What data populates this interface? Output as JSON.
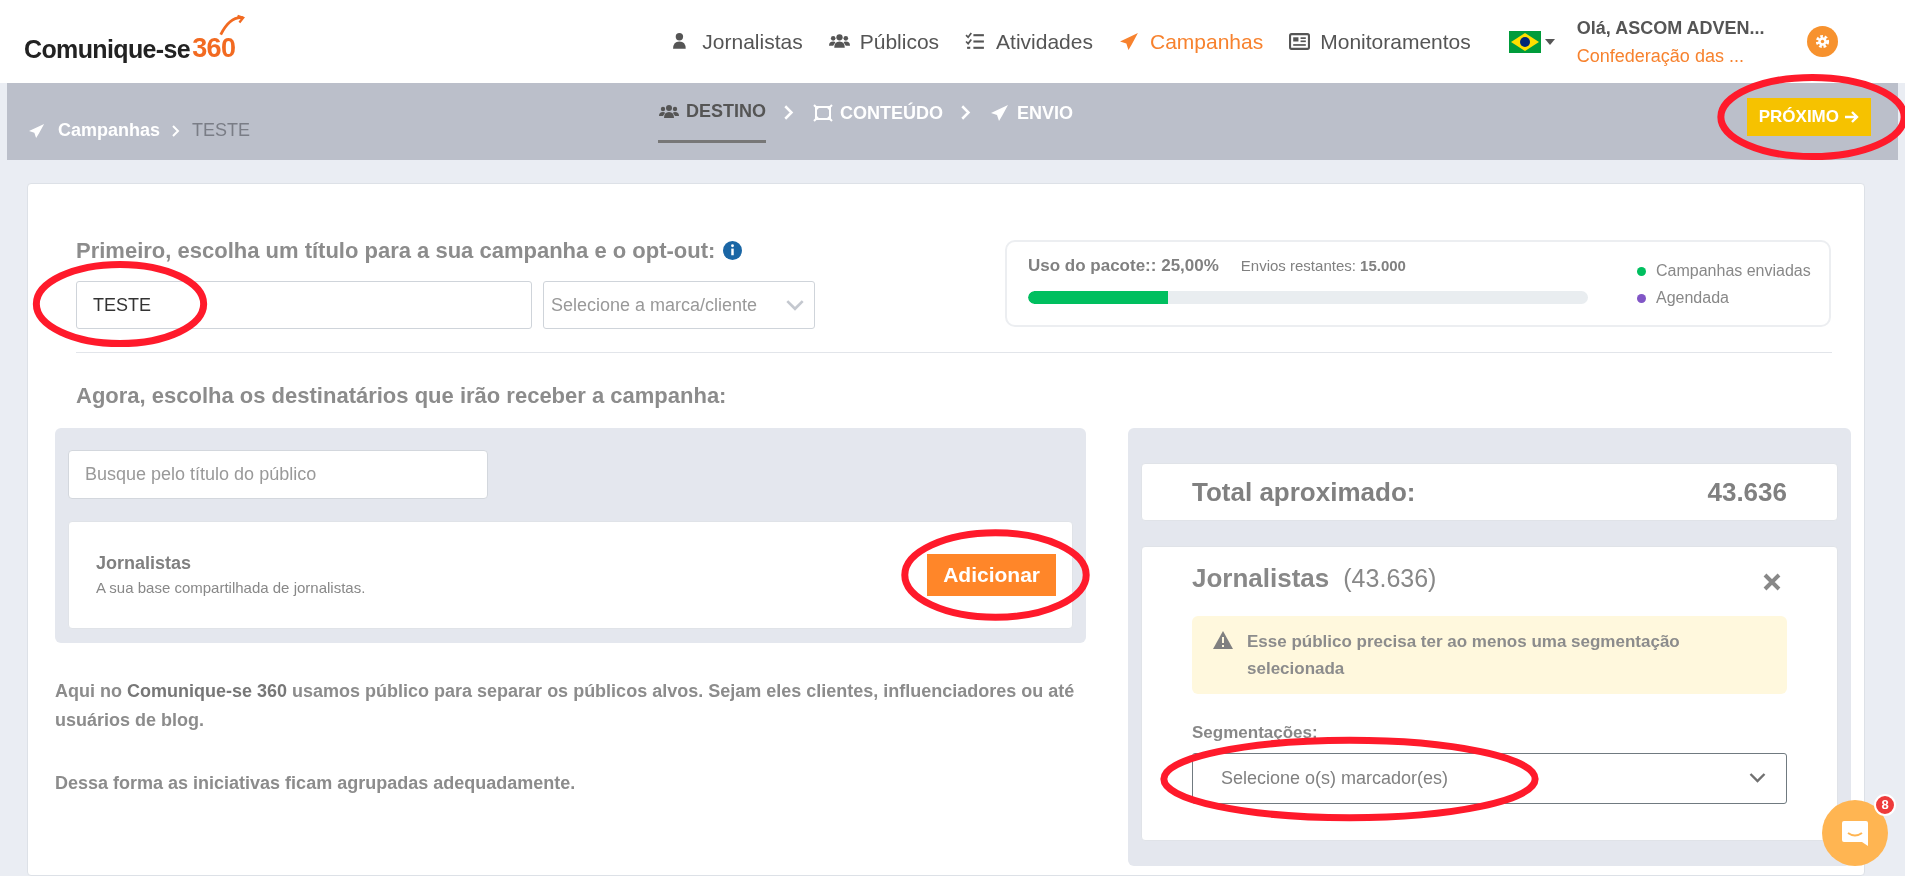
{
  "header": {
    "logo": {
      "text": "Comunique-se",
      "accent": "360"
    },
    "nav": [
      {
        "label": "Jornalistas",
        "selected": false
      },
      {
        "label": "Públicos",
        "selected": false
      },
      {
        "label": "Atividades",
        "selected": false
      },
      {
        "label": "Campanhas",
        "selected": true
      },
      {
        "label": "Monitoramentos",
        "selected": false
      }
    ],
    "user": {
      "greeting": "Olá, ASCOM ADVEN...",
      "org": "Confederação das ..."
    }
  },
  "subbar": {
    "breadcrumb": [
      "Campanhas",
      "TESTE"
    ],
    "steps": [
      {
        "label": "DESTINO",
        "selected": true
      },
      {
        "label": "CONTEÚDO",
        "selected": false
      },
      {
        "label": "ENVIO",
        "selected": false
      }
    ],
    "next_button": {
      "label": "PRÓXIMO",
      "highlighted": true
    }
  },
  "title_section": {
    "prompt": "Primeiro, escolha um título para a sua campanha e o opt-out:",
    "title_field": {
      "value": "TESTE",
      "highlighted": true
    },
    "brand_select": {
      "placeholder": "Selecione a marca/cliente"
    }
  },
  "usage": {
    "label": "Uso do pacote::",
    "percent": "25,00%",
    "level": 0.25,
    "remaining_label": "Envios restantes:",
    "remaining": "15.000",
    "legend": [
      {
        "label": "Campanhas enviadas",
        "color": "#00bf5f"
      },
      {
        "label": "Agendada",
        "color": "#8156c6"
      }
    ]
  },
  "recipients_prompt": "Agora, escolha os destinatários que irão receber a campanha:",
  "audience_search": {
    "placeholder": "Busque pelo título do público"
  },
  "audiences": [
    {
      "name": "Jornalistas",
      "description": "A sua base compartilhada de jornalistas.",
      "button": "Adicionar",
      "highlighted": true
    }
  ],
  "info_paragraphs": [
    "Aqui no **Comunique-se 360** usamos público para separar os públicos alvos. Sejam eles clientes, influenciadores ou até usuários de blog.",
    "Dessa forma as iniciativas ficam agrupadas adequadamente."
  ],
  "summary": {
    "total_label": "Total aproximado:",
    "total": "43.636",
    "selected_audiences": [
      {
        "name": "Jornalistas",
        "count": "(43.636)",
        "warning": "Esse público precisa ter ao menos uma segmentação selecionada",
        "segment_label": "Segmentações:",
        "segment_select": {
          "placeholder": "Selecione o(s) marcador(es)",
          "highlighted": true
        }
      }
    ]
  },
  "chat": {
    "badge": "8"
  }
}
